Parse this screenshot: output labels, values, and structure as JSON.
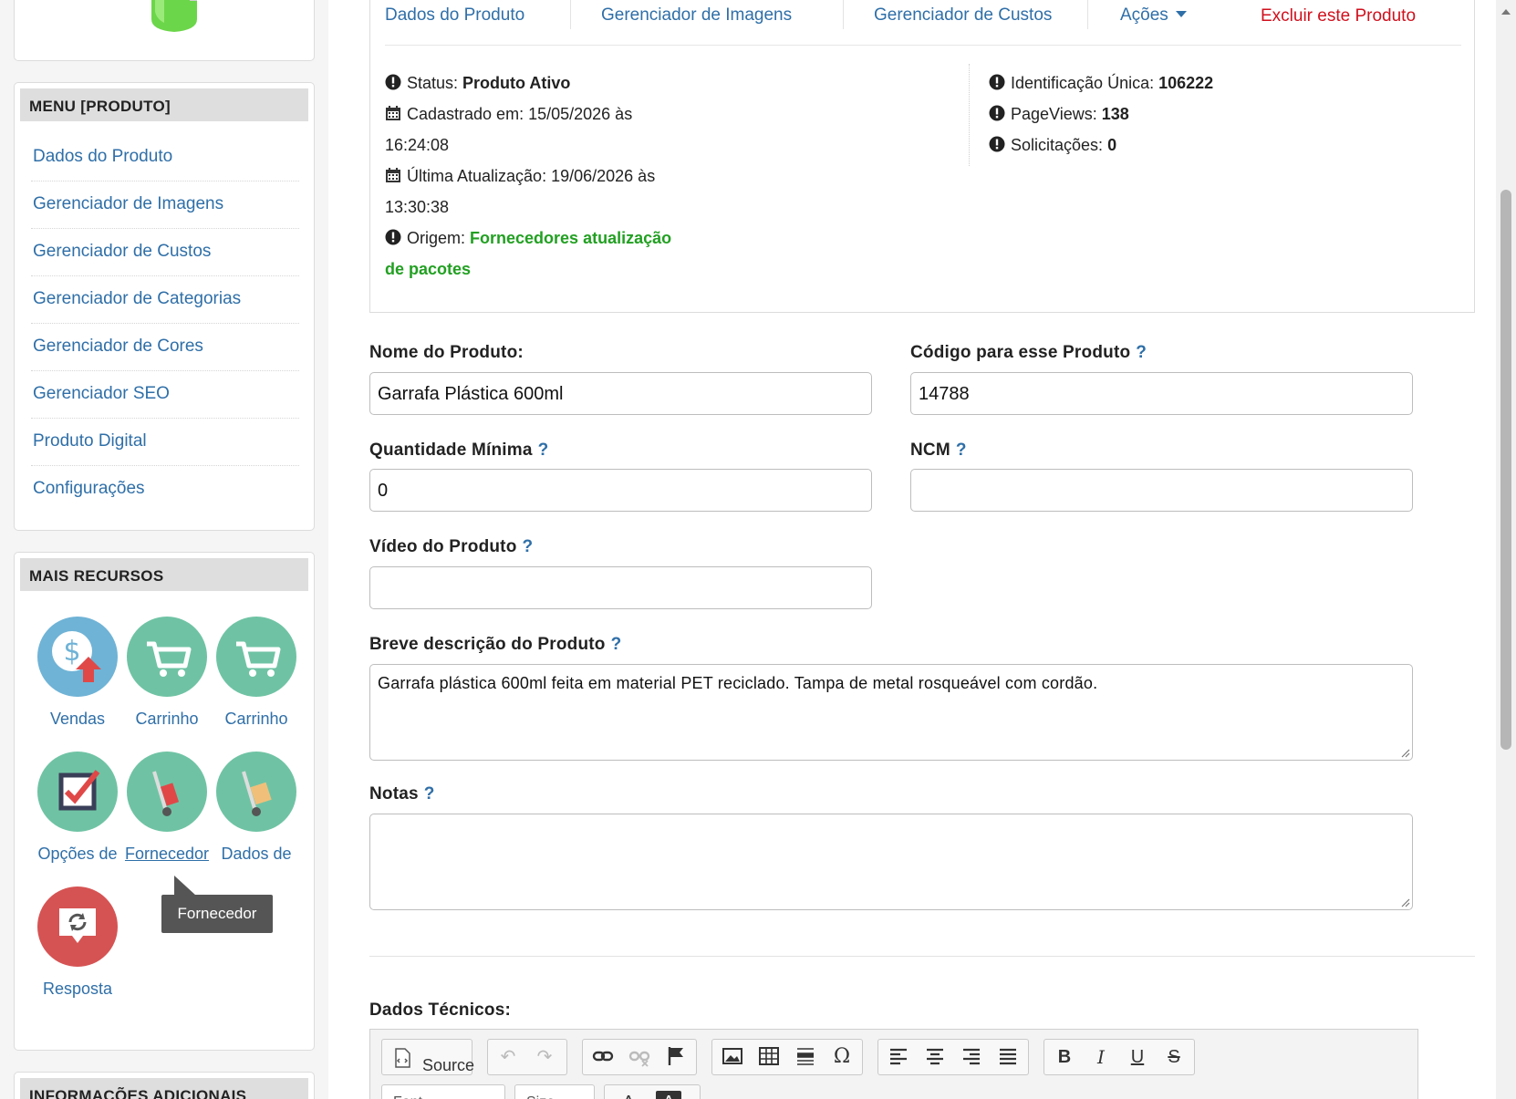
{
  "sidebar": {
    "menu_title": "MENU [PRODUTO]",
    "menu_items": [
      {
        "label": "Dados do Produto"
      },
      {
        "label": "Gerenciador de Imagens"
      },
      {
        "label": "Gerenciador de Custos"
      },
      {
        "label": "Gerenciador de Categorias"
      },
      {
        "label": "Gerenciador de Cores"
      },
      {
        "label": "Gerenciador SEO"
      },
      {
        "label": "Produto Digital"
      },
      {
        "label": "Configurações"
      }
    ],
    "more_title": "MAIS RECURSOS",
    "resources": [
      {
        "label": "Vendas",
        "icon": "sales-dollar-icon"
      },
      {
        "label": "Carrinho",
        "icon": "cart-icon"
      },
      {
        "label": "Carrinho",
        "icon": "cart-icon"
      },
      {
        "label": "Opções de",
        "icon": "checkbox-icon"
      },
      {
        "label": "Fornecedor",
        "icon": "hand-truck-icon"
      },
      {
        "label": "Dados de",
        "icon": "hand-truck-box-icon"
      },
      {
        "label": "Resposta",
        "icon": "refresh-chat-icon"
      }
    ],
    "tooltip": "Fornecedor",
    "info_title": "INFORMAÇÕES ADICIONAIS"
  },
  "tabs": {
    "dados": "Dados do Produto",
    "imagens": "Gerenciador de Imagens",
    "custos": "Gerenciador de Custos",
    "acoes": "Ações",
    "excluir": "Excluir este Produto"
  },
  "status": {
    "status_label": "Status:",
    "status_value": "Produto Ativo",
    "cadastrado_label": "Cadastrado em:",
    "cadastrado_value_1": "15/05/2026 às",
    "cadastrado_value_2": "16:24:08",
    "atualizacao_label": "Última Atualização:",
    "atualizacao_value_1": "19/06/2026 às",
    "atualizacao_value_2": "13:30:38",
    "origem_label": "Origem:",
    "origem_value_1": "Fornecedores atualização",
    "origem_value_2": "de pacotes",
    "id_label": "Identificação Única:",
    "id_value": "106222",
    "pageviews_label": "PageViews:",
    "pageviews_value": "138",
    "solicitacoes_label": "Solicitações:",
    "solicitacoes_value": "0"
  },
  "form": {
    "nome_label": "Nome do Produto:",
    "nome_value": "Garrafa Plástica 600ml",
    "codigo_label": "Código para esse Produto",
    "codigo_value": "14788",
    "qtd_label": "Quantidade Mínima",
    "qtd_value": "0",
    "ncm_label": "NCM",
    "ncm_value": "",
    "video_label": "Vídeo do Produto",
    "video_value": "",
    "breve_label": "Breve descrição do Produto",
    "breve_value": "Garrafa plástica 600ml feita em material PET reciclado. Tampa de metal rosqueável com cordão.",
    "notas_label": "Notas",
    "notas_value": "",
    "help": "?",
    "tecnicos_label": "Dados Técnicos:"
  },
  "editor": {
    "source_label": "Source",
    "font_label": "Font",
    "size_label": "Size"
  },
  "colors": {
    "link": "#2f6fa8",
    "danger": "#d0101d",
    "success": "#22a022"
  }
}
